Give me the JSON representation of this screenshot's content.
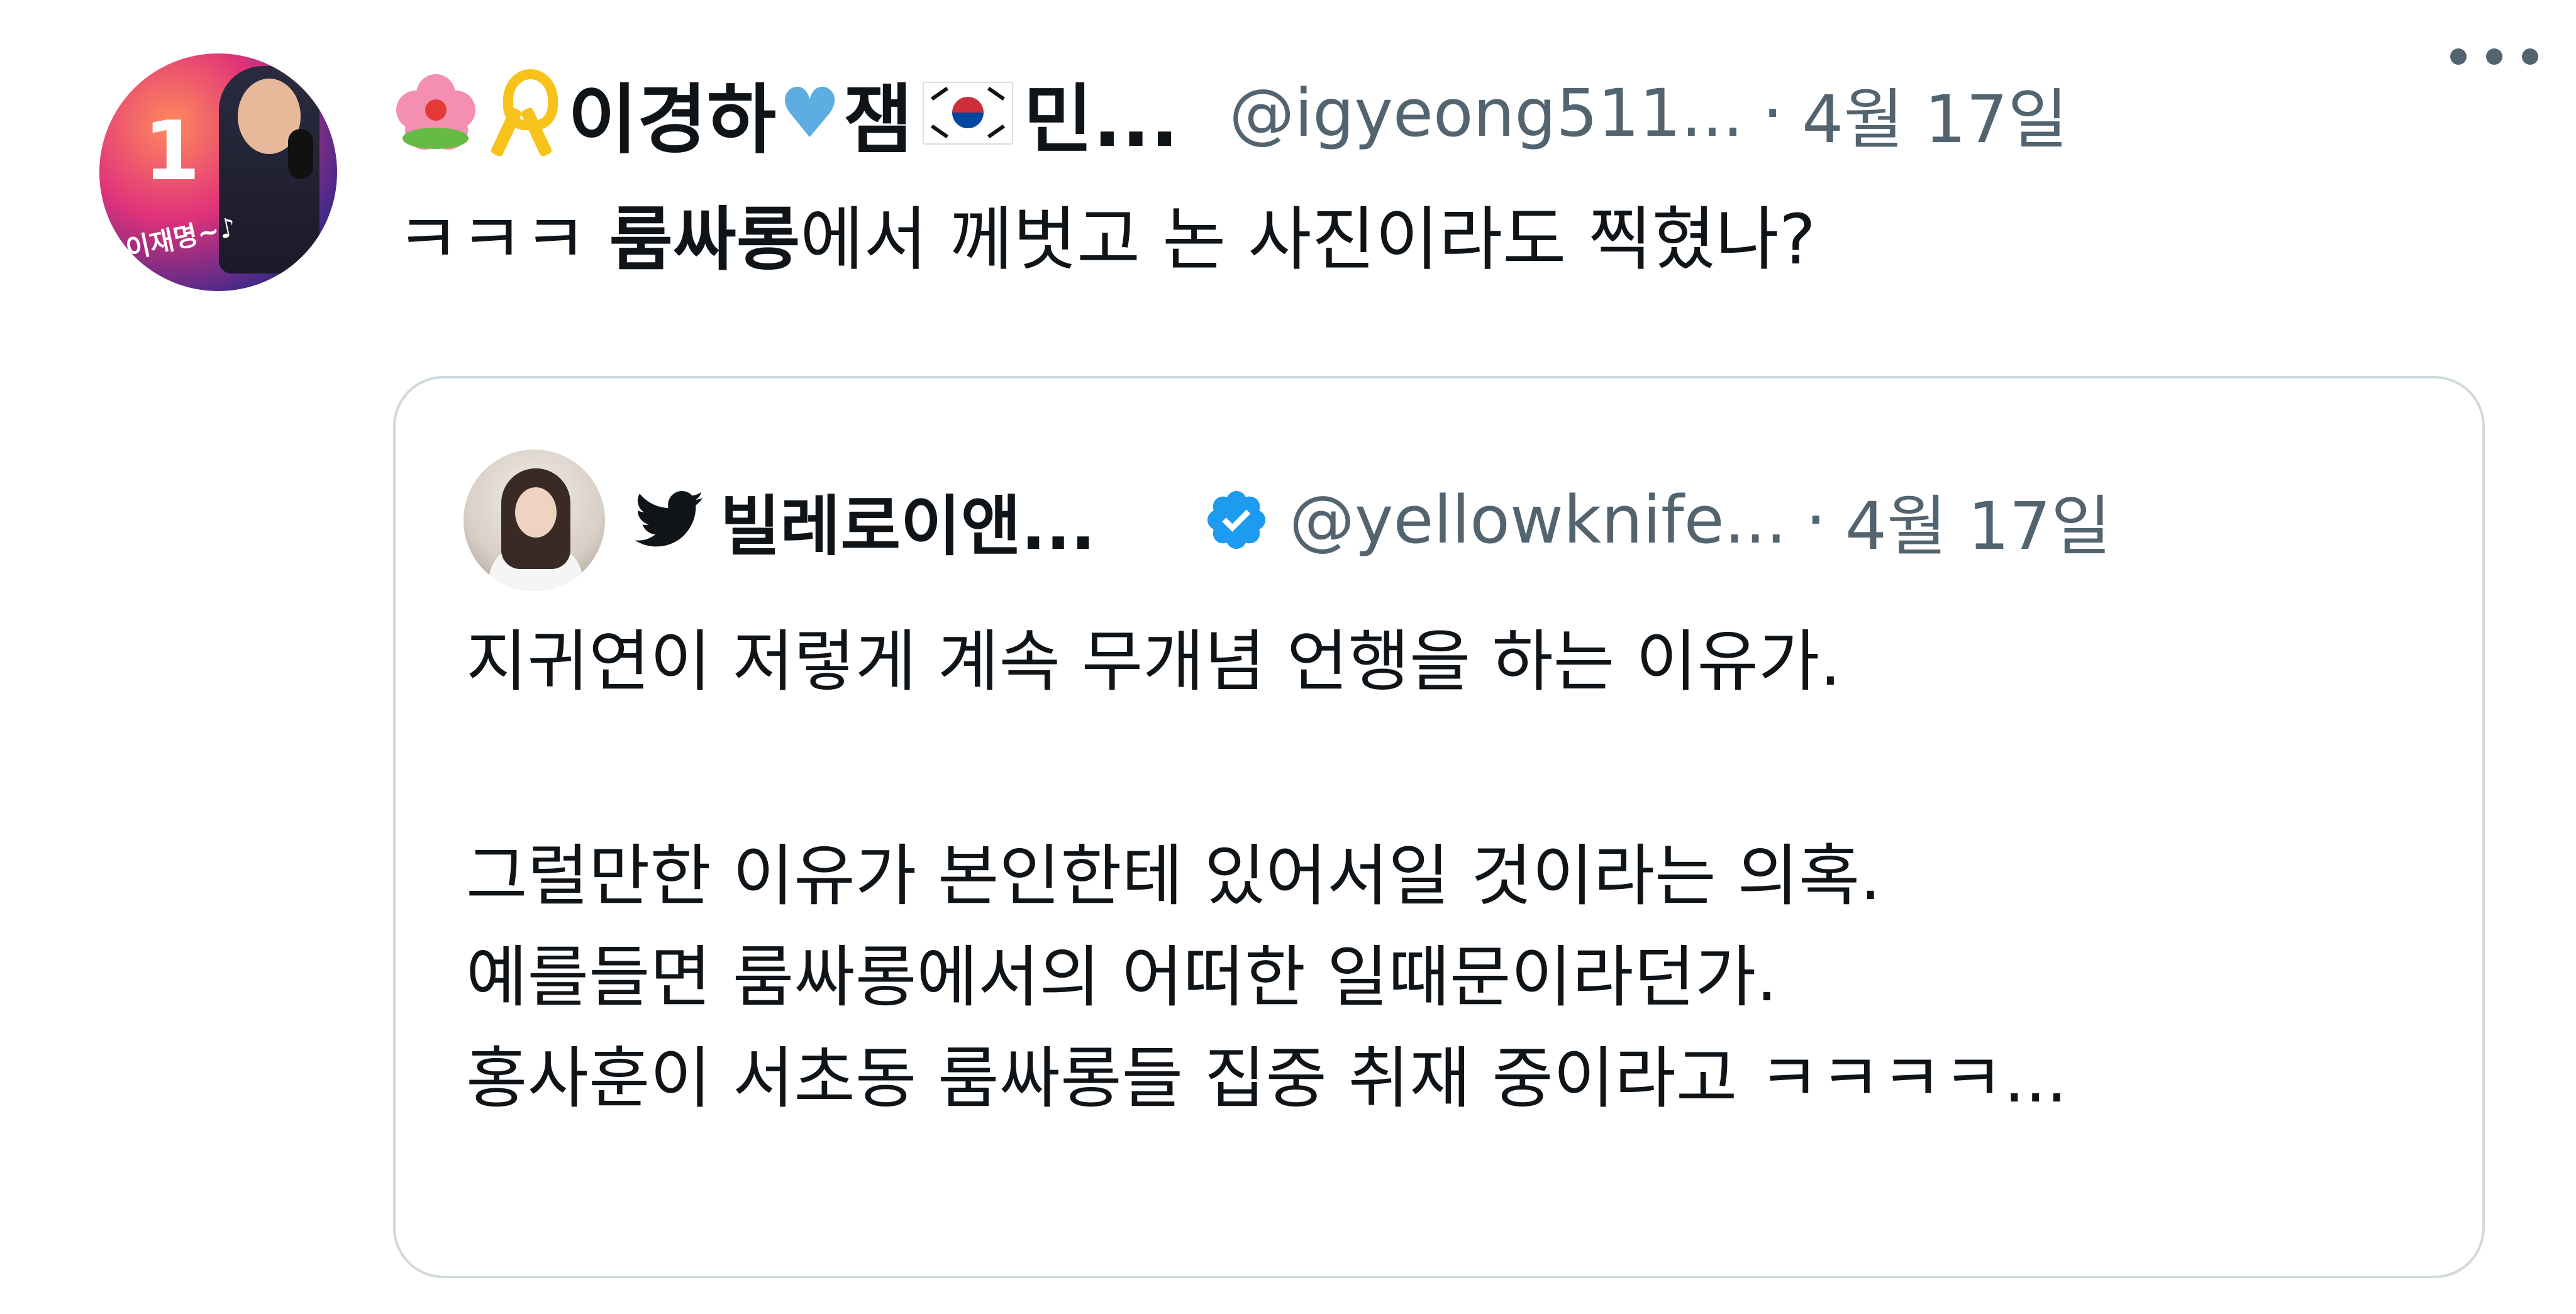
{
  "tweet": {
    "author": {
      "display_name_part1": "이경하",
      "display_name_part2": "잼",
      "display_name_part3": "민...",
      "handle": "@igyeong511...",
      "avatar_text_number": "1",
      "avatar_text_tag": "이재명~♪",
      "emoji_icons": [
        "hibiscus-icon",
        "yellow-ribbon-icon",
        "blue-heart-icon",
        "korea-flag-icon"
      ]
    },
    "separator": "·",
    "date": "4월 17일",
    "text_before": "ㅋㅋㅋ ",
    "text_bold": "룸싸롱",
    "text_after": "에서 께벗고 논 사진이라도 찍혔나?"
  },
  "quoted_tweet": {
    "author": {
      "display_name": "빌레로이앤...",
      "handle": "@yellowknife...",
      "verified": true
    },
    "separator": "·",
    "date": "4월 17일",
    "paragraphs": [
      [
        "지귀연이 저렇게 계속 무개념 언행을 하는 이유가."
      ],
      [
        "그럴만한 이유가 본인한테 있어서일 것이라는 의혹.",
        "예를들면 룸싸롱에서의 어떠한 일때문이라던가.",
        "홍사훈이 서초동 룸싸롱들 집중 취재 중이라고 ㅋㅋㅋㅋ..."
      ]
    ]
  },
  "colors": {
    "text_primary": "#0f1419",
    "text_secondary": "#536471",
    "border": "#cfd9de",
    "verified_blue": "#1d9bf0",
    "heart_blue": "#5dade2",
    "ribbon_yellow": "#f7c31b"
  }
}
